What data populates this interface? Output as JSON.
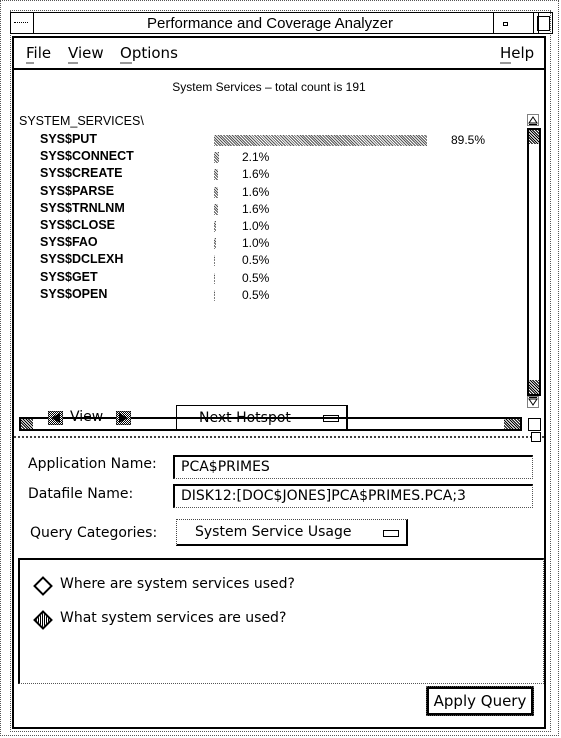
{
  "window": {
    "title": "Performance and Coverage Analyzer"
  },
  "menubar": {
    "items": [
      {
        "label": "File",
        "mnemonic": "F"
      },
      {
        "label": "View",
        "mnemonic": "V"
      },
      {
        "label": "Options",
        "mnemonic": "O"
      }
    ],
    "help": {
      "label": "Help",
      "mnemonic": "H"
    }
  },
  "chart_data": {
    "type": "bar",
    "title": "System Services – total count is 191",
    "root": "SYSTEM_SERVICES\\",
    "categories": [
      "SYS$PUT",
      "SYS$CONNECT",
      "SYS$CREATE",
      "SYS$PARSE",
      "SYS$TRNLNM",
      "SYS$CLOSE",
      "SYS$FAO",
      "SYS$DCLEXH",
      "SYS$GET",
      "SYS$OPEN"
    ],
    "values": [
      89.5,
      2.1,
      1.6,
      1.6,
      1.6,
      1.0,
      1.0,
      0.5,
      0.5,
      0.5
    ],
    "labels": [
      "89.5%",
      "2.1%",
      "1.6%",
      "1.6%",
      "1.6%",
      "1.0%",
      "1.0%",
      "0.5%",
      "0.5%",
      "0.5%"
    ],
    "xlabel": "",
    "ylabel": "",
    "xlim": [
      0,
      100
    ],
    "orientation": "horizontal",
    "grid": false
  },
  "view_controls": {
    "label": "View",
    "prev_icon": "left-arrow-icon",
    "next_icon": "right-arrow-icon",
    "hotspot_label": "Next Hotspot"
  },
  "form": {
    "application_name_label": "Application Name:",
    "application_name_value": "PCA$PRIMES",
    "datafile_name_label": "Datafile Name:",
    "datafile_name_value": "DISK12:[DOC$JONES]PCA$PRIMES.PCA;3",
    "query_categories_label": "Query Categories:",
    "query_categories_value": "System Service Usage"
  },
  "queries": {
    "options": [
      {
        "label": "Where are system services used?",
        "selected": false
      },
      {
        "label": "What system services are used?",
        "selected": true
      }
    ]
  },
  "apply_button": {
    "label": "Apply Query"
  }
}
